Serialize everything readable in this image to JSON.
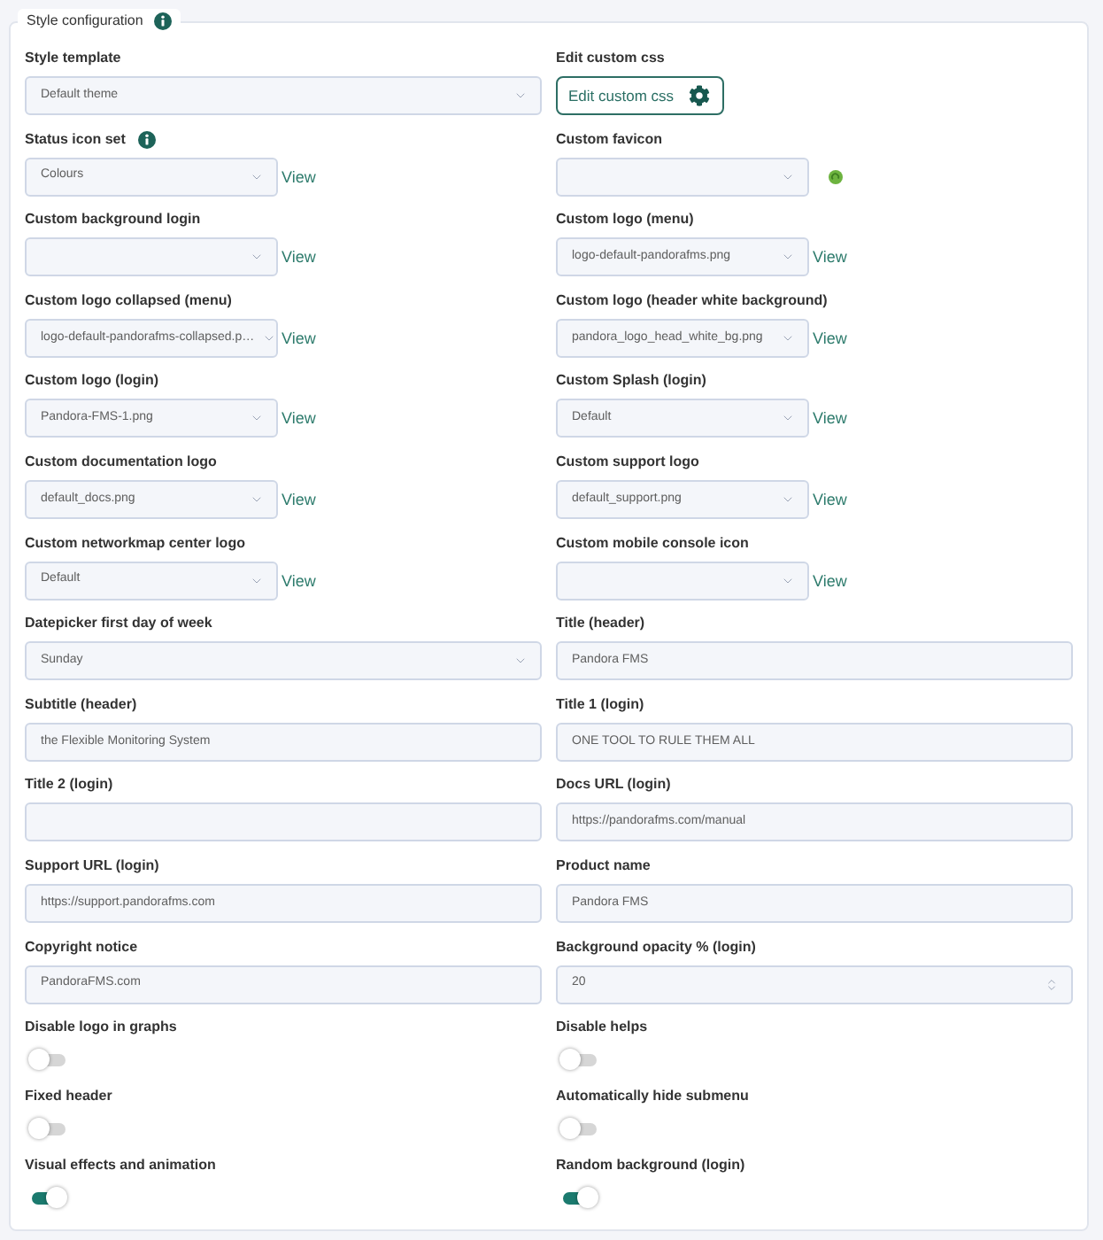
{
  "section": {
    "title": "Style configuration",
    "help": true
  },
  "fields": [
    {
      "label": "Style template",
      "kind": "select",
      "value": "Default theme"
    },
    {
      "label": "Edit custom css",
      "kind": "button",
      "value": "Edit custom css"
    },
    {
      "label": "Status icon set",
      "help": true,
      "kind": "select_link",
      "value": "Colours",
      "link": "View"
    },
    {
      "label": "Custom favicon",
      "kind": "select_preview"
    },
    {
      "label": "Custom background login",
      "kind": "select_link",
      "link": "View"
    },
    {
      "label": "Custom logo (menu)",
      "kind": "select_link",
      "value": "logo-default-pandorafms.png",
      "link": "View"
    },
    {
      "label": "Custom logo collapsed (menu)",
      "kind": "select_link",
      "value": "logo-default-pandorafms-collapsed.p…",
      "link": "View"
    },
    {
      "label": "Custom logo (header white background)",
      "kind": "select_link",
      "value": "pandora_logo_head_white_bg.png",
      "link": "View"
    },
    {
      "label": "Custom logo (login)",
      "kind": "select_link",
      "value": "Pandora-FMS-1.png",
      "link": "View"
    },
    {
      "label": "Custom Splash (login)",
      "kind": "select_link",
      "value": "Default",
      "link": "View"
    },
    {
      "label": "Custom documentation logo",
      "kind": "select_link",
      "value": "default_docs.png",
      "link": "View"
    },
    {
      "label": "Custom support logo",
      "kind": "select_link",
      "value": "default_support.png",
      "link": "View"
    },
    {
      "label": "Custom networkmap center logo",
      "kind": "select_link",
      "value": "Default",
      "link": "View"
    },
    {
      "label": "Custom mobile console icon",
      "kind": "select_link",
      "link": "View"
    },
    {
      "label": "Datepicker first day of week",
      "kind": "select",
      "value": "Sunday"
    },
    {
      "label": "Title (header)",
      "kind": "text",
      "value": "Pandora FMS"
    },
    {
      "label": "Subtitle (header)",
      "kind": "text",
      "value": "the Flexible Monitoring System"
    },
    {
      "label": "Title 1 (login)",
      "kind": "text",
      "value": "ONE TOOL TO RULE THEM ALL"
    },
    {
      "label": "Title 2 (login)",
      "kind": "text"
    },
    {
      "label": "Docs URL (login)",
      "kind": "text",
      "value": "https://pandorafms.com/manual"
    },
    {
      "label": "Support URL (login)",
      "kind": "text",
      "value": "https://support.pandorafms.com"
    },
    {
      "label": "Product name",
      "kind": "text",
      "value": "Pandora FMS"
    },
    {
      "label": "Copyright notice",
      "kind": "text",
      "value": "PandoraFMS.com"
    },
    {
      "label": "Background opacity % (login)",
      "kind": "number",
      "value": "20"
    },
    {
      "label": "Disable logo in graphs",
      "kind": "toggle",
      "on": false
    },
    {
      "label": "Disable helps",
      "kind": "toggle",
      "on": false
    },
    {
      "label": "Fixed header",
      "kind": "toggle",
      "on": false
    },
    {
      "label": "Automatically hide submenu",
      "kind": "toggle",
      "on": false
    },
    {
      "label": "Visual effects and animation",
      "kind": "toggle",
      "on": true
    },
    {
      "label": "Random background (login)",
      "kind": "toggle",
      "on": true
    }
  ]
}
